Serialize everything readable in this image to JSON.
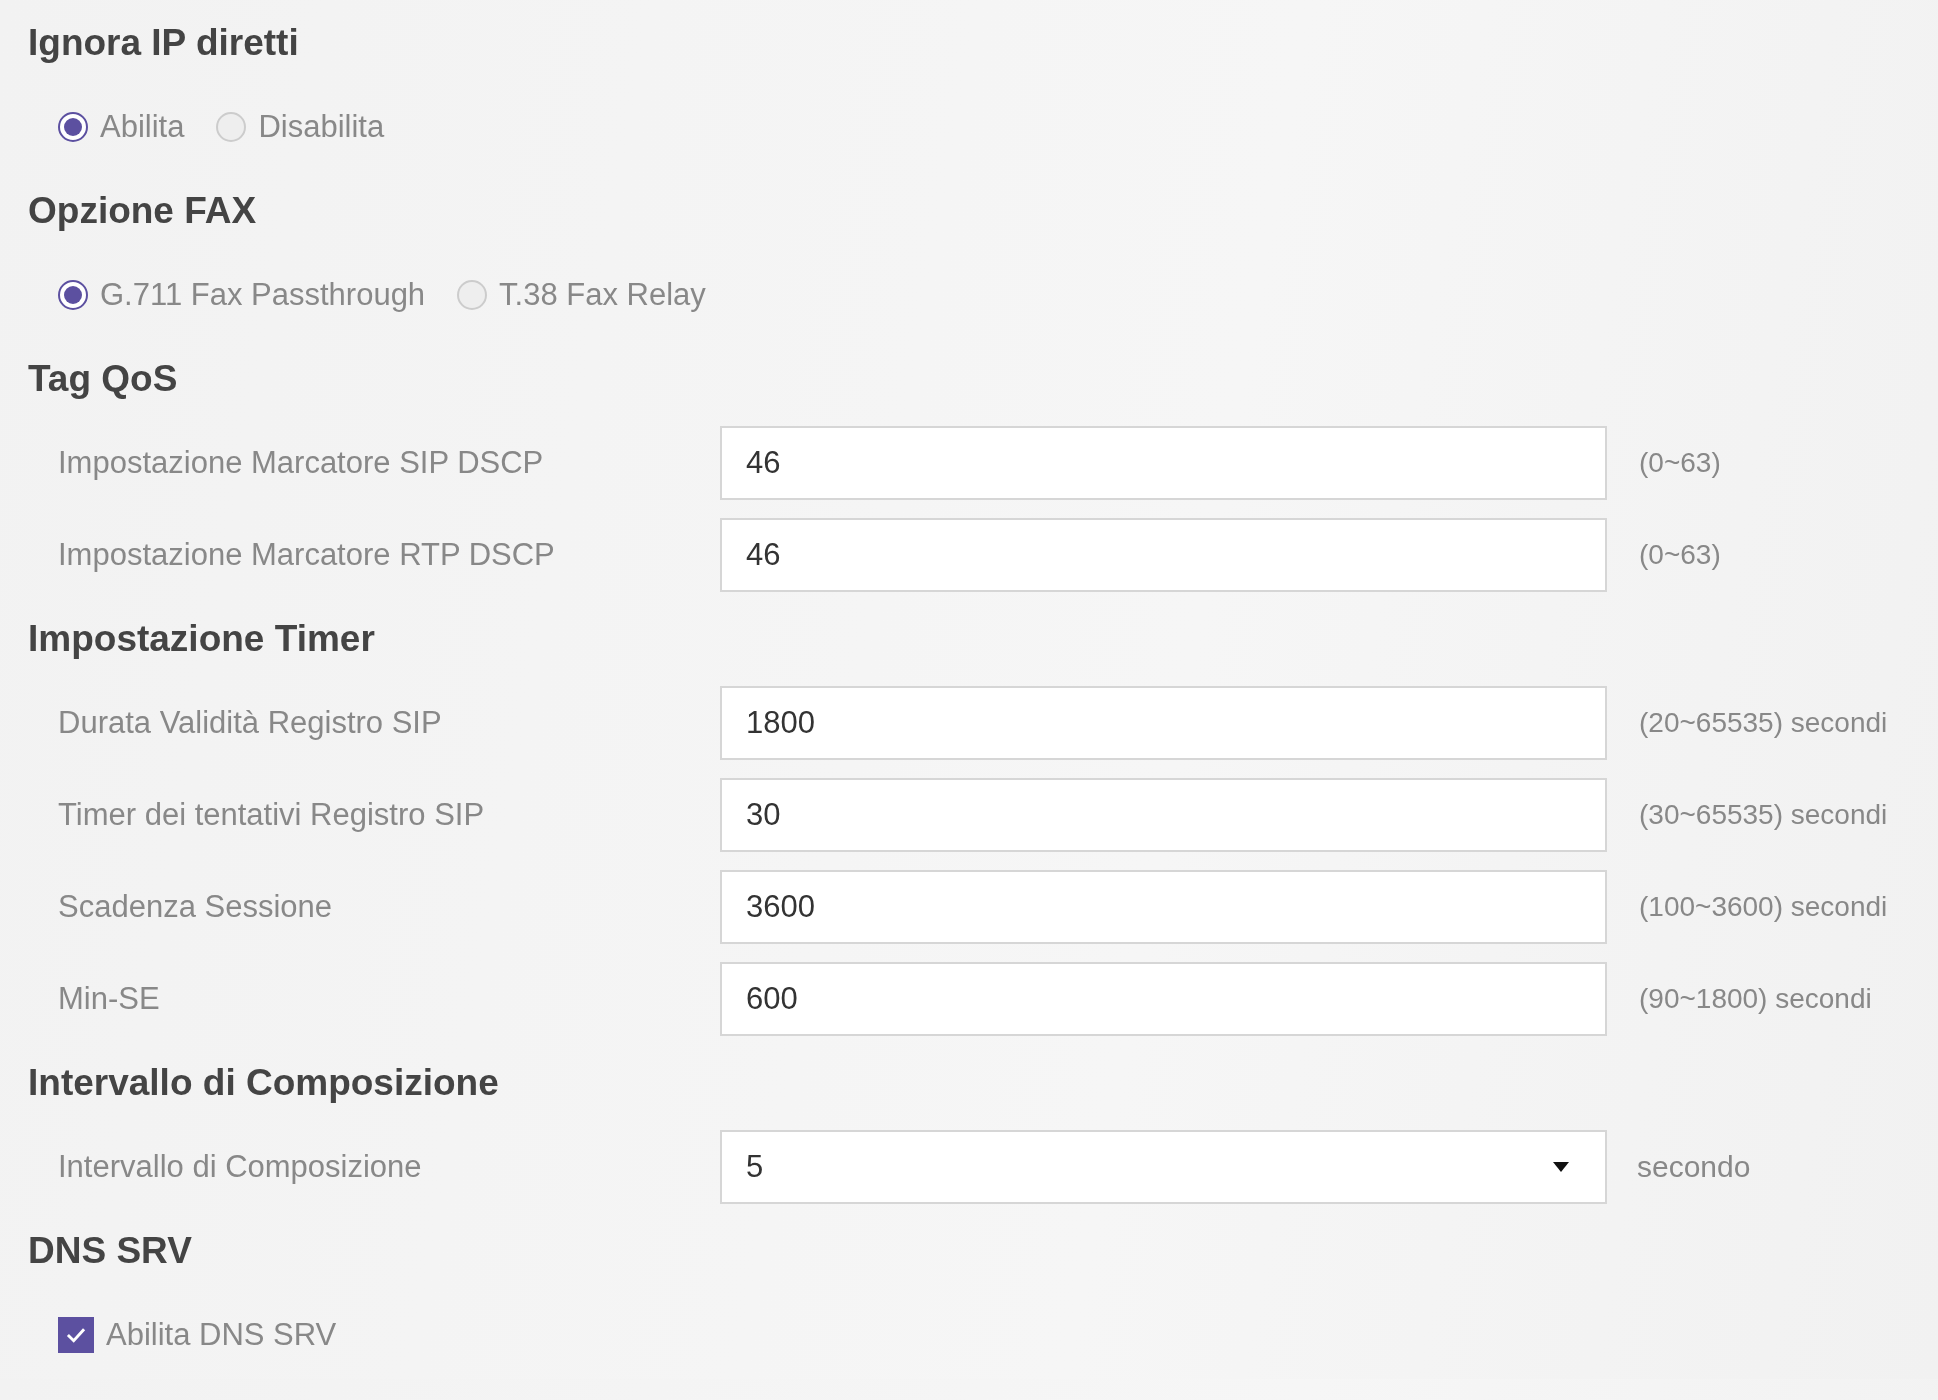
{
  "sections": [
    {
      "kind": "radio",
      "title": "Ignora IP diretti",
      "options": [
        {
          "label": "Abilita",
          "selected": true
        },
        {
          "label": "Disabilita",
          "selected": false
        }
      ]
    },
    {
      "kind": "radio",
      "title": "Opzione FAX",
      "options": [
        {
          "label": "G.711 Fax Passthrough",
          "selected": true
        },
        {
          "label": "T.38 Fax Relay",
          "selected": false
        }
      ]
    },
    {
      "kind": "fields",
      "title": "Tag QoS",
      "fields": [
        {
          "kind": "input",
          "label": "Impostazione Marcatore SIP DSCP",
          "value": "46",
          "hint": "(0~63)"
        },
        {
          "kind": "input",
          "label": "Impostazione Marcatore RTP DSCP",
          "value": "46",
          "hint": "(0~63)"
        }
      ]
    },
    {
      "kind": "fields",
      "title": "Impostazione Timer",
      "fields": [
        {
          "kind": "input",
          "label": "Durata Validità Registro SIP",
          "value": "1800",
          "hint": "(20~65535) secondi"
        },
        {
          "kind": "input",
          "label": "Timer dei tentativi Registro SIP",
          "value": "30",
          "hint": "(30~65535) secondi"
        },
        {
          "kind": "input",
          "label": "Scadenza Sessione",
          "value": "3600",
          "hint": "(100~3600) secondi"
        },
        {
          "kind": "input",
          "label": "Min-SE",
          "value": "600",
          "hint": "(90~1800) secondi"
        }
      ]
    },
    {
      "kind": "fields",
      "title": "Intervallo di Composizione",
      "fields": [
        {
          "kind": "select",
          "label": "Intervallo di Composizione",
          "value": "5",
          "hint": "secondo"
        }
      ]
    },
    {
      "kind": "checkbox",
      "title": "DNS SRV",
      "options": [
        {
          "label": "Abilita DNS SRV",
          "checked": true
        }
      ]
    }
  ]
}
